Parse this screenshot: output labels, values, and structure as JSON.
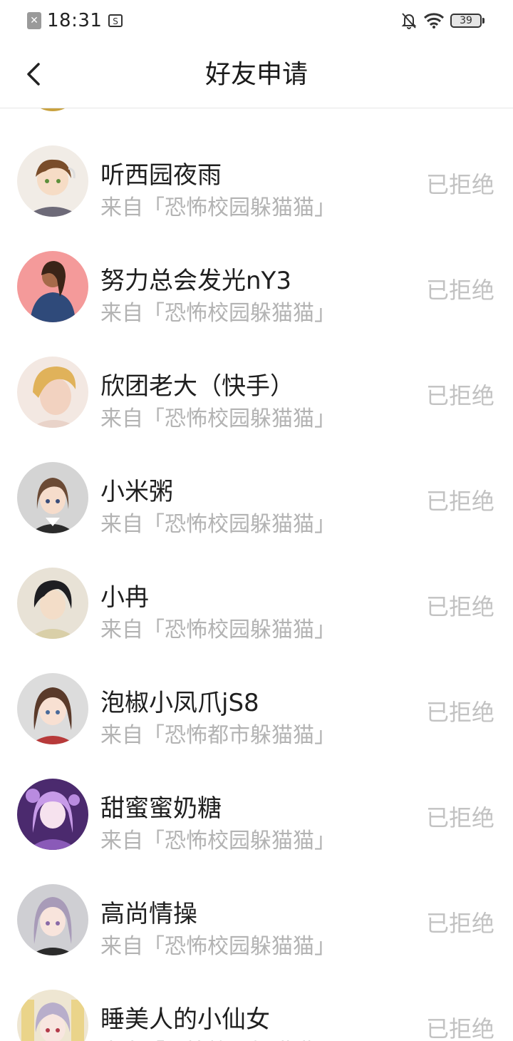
{
  "status_bar": {
    "time": "18:31",
    "battery_level": "39"
  },
  "nav": {
    "title": "好友申请"
  },
  "requests": [
    {
      "name": "听西园夜雨",
      "source": "来自「恐怖校园躲猫猫」",
      "status": "已拒绝",
      "avatar": "avatar-boy-glasses"
    },
    {
      "name": "努力总会发光nY3",
      "source": "来自「恐怖校园躲猫猫」",
      "status": "已拒绝",
      "avatar": "avatar-girl-blue-jacket"
    },
    {
      "name": "欣团老大（快手）",
      "source": "来自「恐怖校园躲猫猫」",
      "status": "已拒绝",
      "avatar": "avatar-blond-portrait"
    },
    {
      "name": "小米粥",
      "source": "来自「恐怖校园躲猫猫」",
      "status": "已拒绝",
      "avatar": "avatar-anime-girl-brown"
    },
    {
      "name": "小冉",
      "source": "来自「恐怖校园躲猫猫」",
      "status": "已拒绝",
      "avatar": "avatar-anime-boy-dark"
    },
    {
      "name": "泡椒小凤爪jS8",
      "source": "来自「恐怖都市躲猫猫」",
      "status": "已拒绝",
      "avatar": "avatar-anime-girl-red"
    },
    {
      "name": "甜蜜蜜奶糖",
      "source": "来自「恐怖校园躲猫猫」",
      "status": "已拒绝",
      "avatar": "avatar-anime-girl-purple"
    },
    {
      "name": "高尚情操",
      "source": "来自「恐怖校园躲猫猫」",
      "status": "已拒绝",
      "avatar": "avatar-anime-girl-lilac"
    },
    {
      "name": "睡美人的小仙女",
      "source": "来自「恐怖校园躲猫猫」",
      "status": "已拒绝",
      "avatar": "avatar-anime-girl-twintails"
    }
  ],
  "colors": {
    "name_text": "#1f1f1f",
    "secondary_text": "#b3b3b3",
    "status_text": "#c2c2c2",
    "divider": "#e6e6e6"
  }
}
